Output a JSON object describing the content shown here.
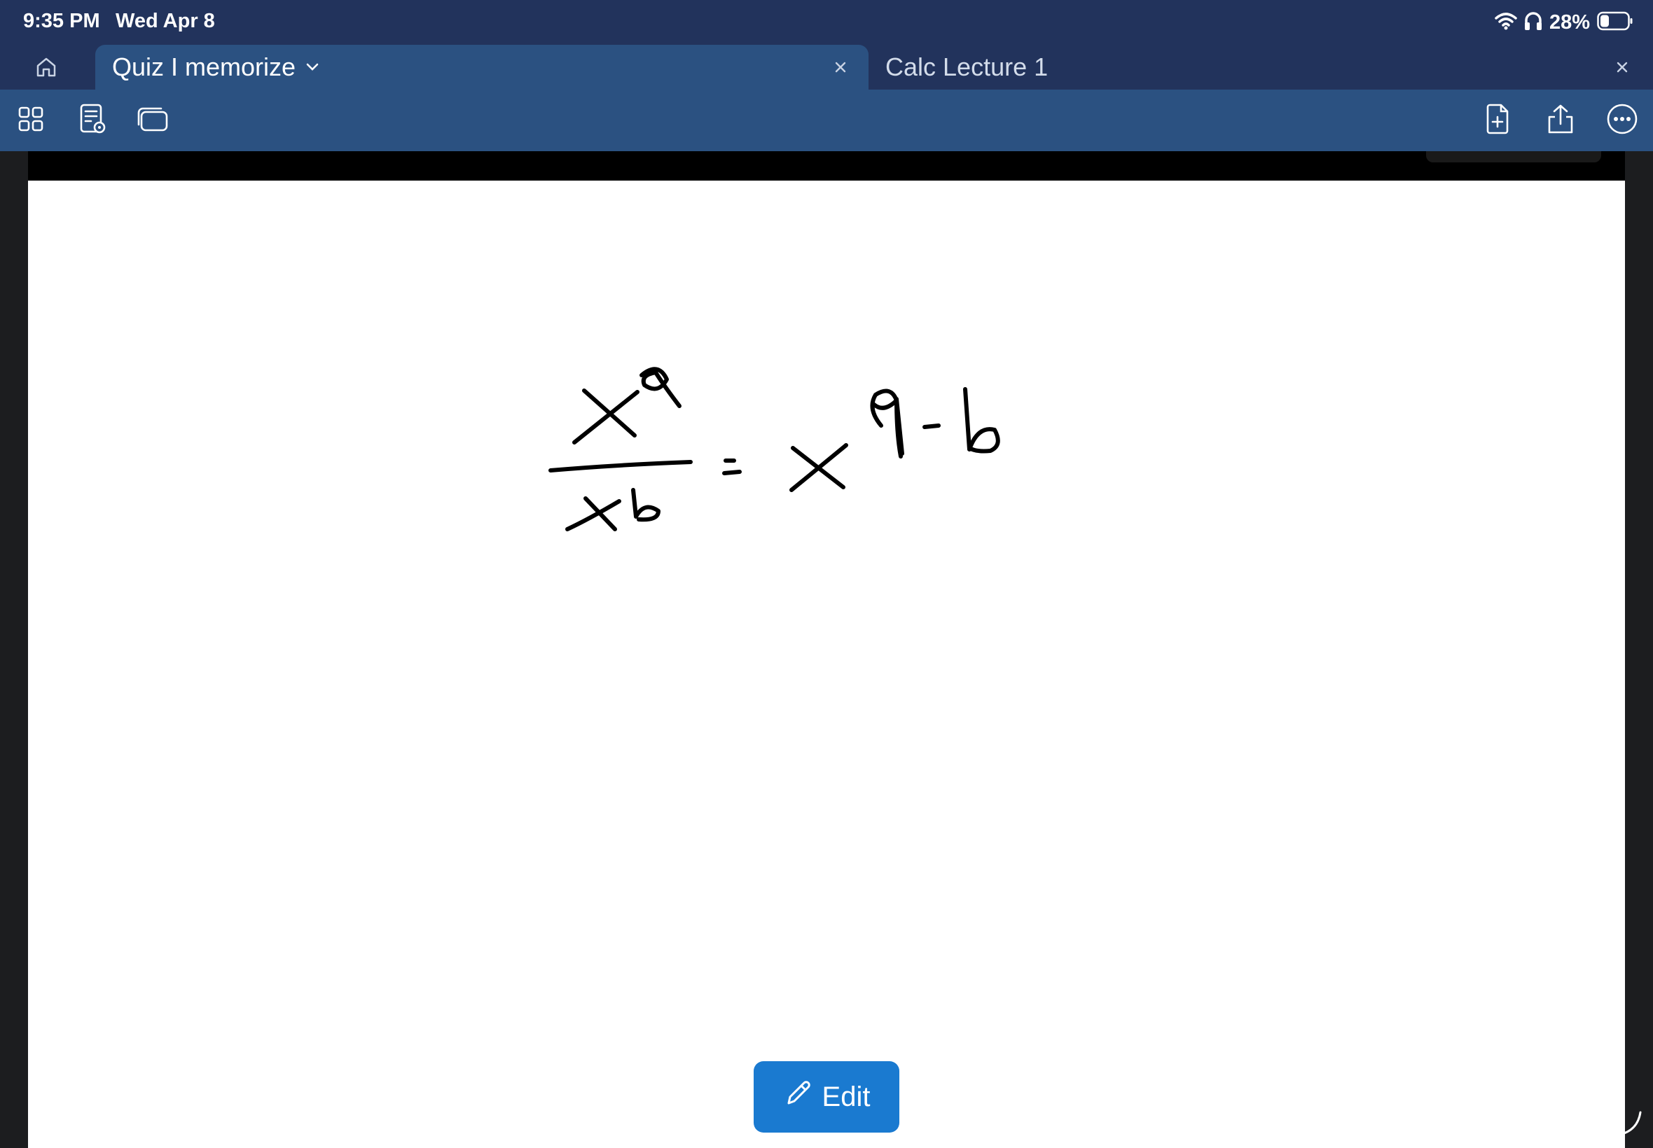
{
  "status_bar": {
    "time": "9:35 PM",
    "date": "Wed Apr 8",
    "battery": "28%",
    "icons": [
      "wifi-icon",
      "headphones-icon",
      "battery-icon"
    ]
  },
  "tabs": [
    {
      "label": "Quiz I memorize",
      "active": true
    },
    {
      "label": "Calc Lecture 1",
      "active": false
    }
  ],
  "toolbar": {
    "left_icons": [
      "grid-icon",
      "page-view-icon",
      "windows-icon"
    ],
    "right_icons": [
      "add-page-icon",
      "share-icon",
      "more-icon"
    ]
  },
  "handwriting": {
    "equation": "x^a / x^b = x^(a-b)"
  },
  "edit_button": {
    "label": "Edit"
  },
  "colors": {
    "header_bg": "#22335c",
    "toolbar_bg": "#2b5181",
    "edit_button": "#1a7ad0",
    "page_bg": "#ffffff"
  }
}
